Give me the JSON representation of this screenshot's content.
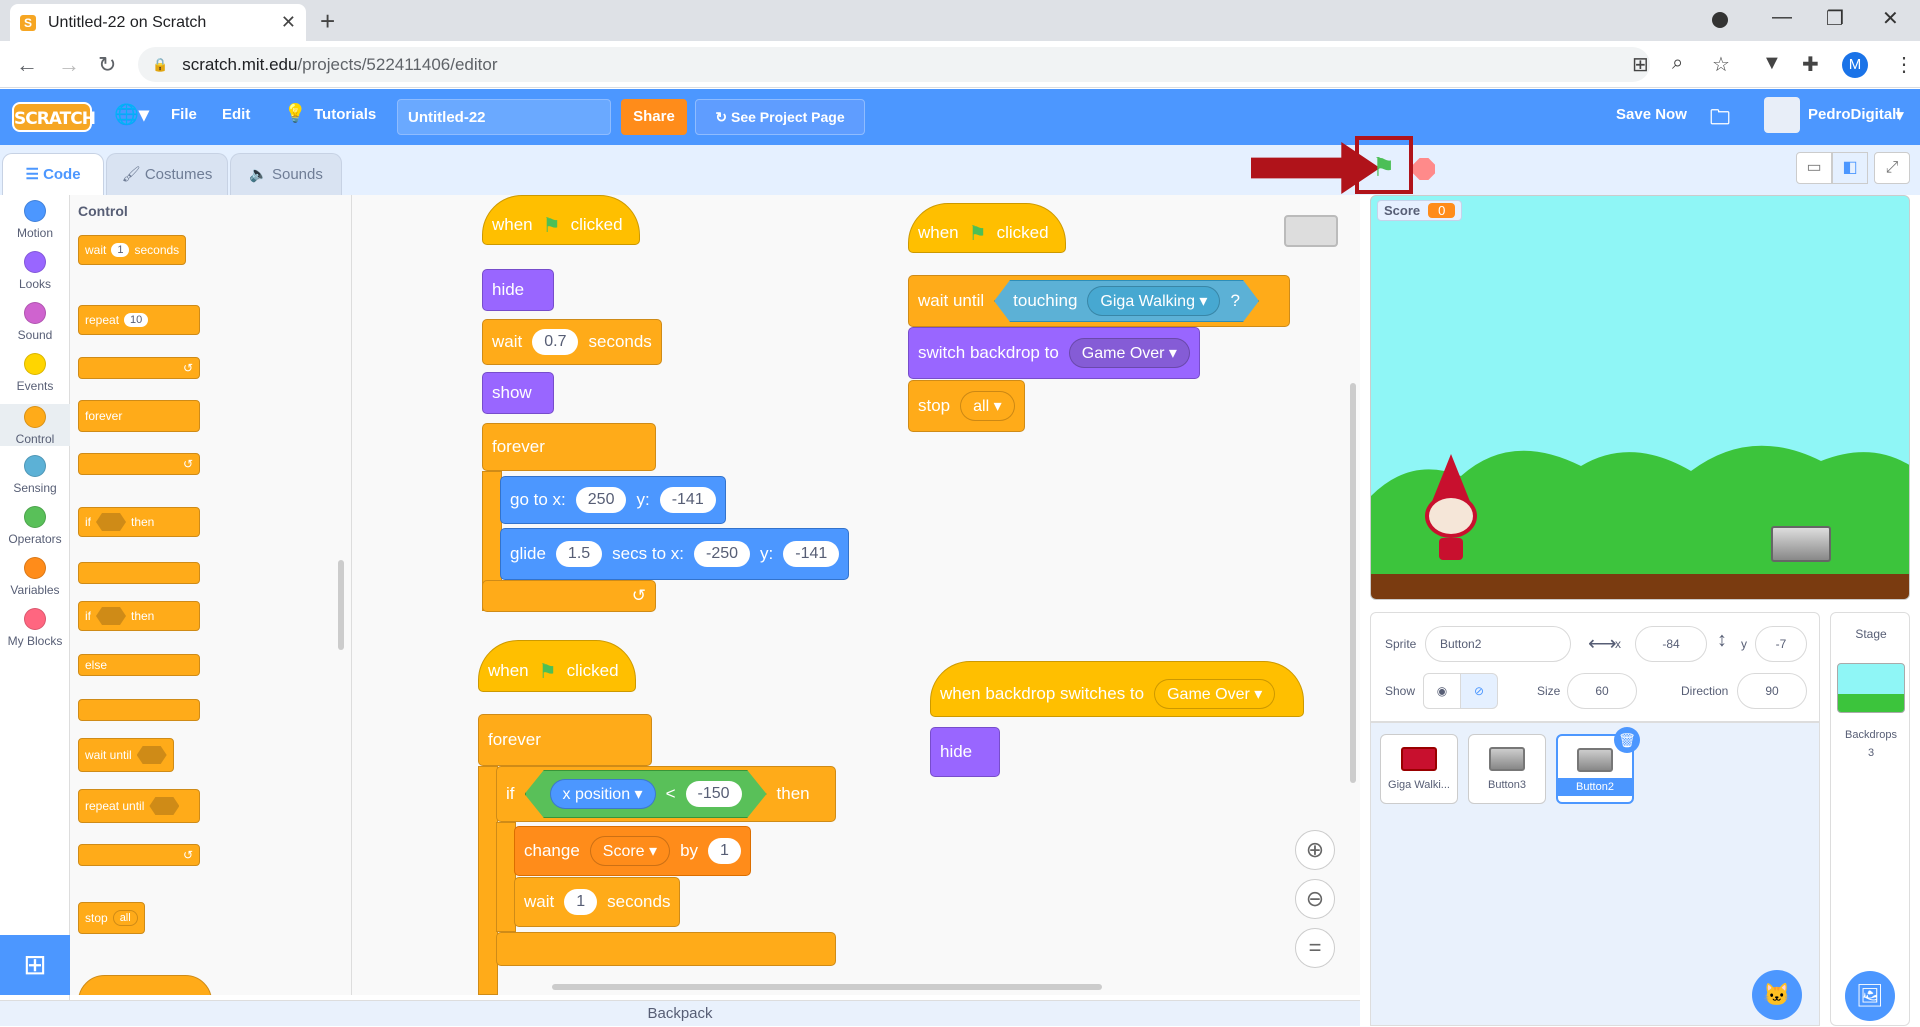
{
  "browser": {
    "tab_title": "Untitled-22 on Scratch",
    "url_host": "scratch.mit.edu",
    "url_path": "/projects/522411406/editor",
    "profile_initial": "M"
  },
  "menu": {
    "logo": "SCRATCH",
    "file": "File",
    "edit": "Edit",
    "tutorials": "Tutorials",
    "project_title": "Untitled-22",
    "share": "Share",
    "see_project": "See Project Page",
    "save_now": "Save Now",
    "username": "PedroDigitall"
  },
  "tabs": {
    "code": "Code",
    "costumes": "Costumes",
    "sounds": "Sounds"
  },
  "categories": [
    {
      "label": "Motion",
      "color": "#4c97ff"
    },
    {
      "label": "Looks",
      "color": "#9966ff"
    },
    {
      "label": "Sound",
      "color": "#cf63cf"
    },
    {
      "label": "Events",
      "color": "#ffd500"
    },
    {
      "label": "Control",
      "color": "#ffab19"
    },
    {
      "label": "Sensing",
      "color": "#5cb1d6"
    },
    {
      "label": "Operators",
      "color": "#59c059"
    },
    {
      "label": "Variables",
      "color": "#ff8c1a"
    },
    {
      "label": "My Blocks",
      "color": "#ff6680"
    }
  ],
  "palette": {
    "heading": "Control",
    "wait": "wait",
    "wait_val": "1",
    "seconds": "seconds",
    "repeat": "repeat",
    "repeat_val": "10",
    "forever": "forever",
    "if": "if",
    "then": "then",
    "else": "else",
    "wait_until": "wait until",
    "repeat_until": "repeat until",
    "stop": "stop",
    "stop_val": "all"
  },
  "scripts": {
    "s1": {
      "when": "when",
      "clicked": "clicked",
      "hide": "hide",
      "wait": "wait",
      "wait_val": "0.7",
      "seconds": "seconds",
      "show": "show",
      "forever": "forever",
      "goto": "go to x:",
      "goto_x": "250",
      "y": "y:",
      "goto_y": "-141",
      "glide": "glide",
      "glide_secs": "1.5",
      "secs_to_x": "secs to x:",
      "glide_x": "-250",
      "glide_y": "-141"
    },
    "s2": {
      "when": "when",
      "clicked": "clicked",
      "wait_until": "wait until",
      "touching": "touching",
      "target": "Giga Walking",
      "q": "?",
      "switch": "switch backdrop to",
      "backdrop": "Game Over",
      "stop": "stop",
      "stop_val": "all"
    },
    "s3": {
      "when": "when",
      "clicked": "clicked",
      "forever": "forever",
      "if": "if",
      "xpos": "x position",
      "lt": "<",
      "cmp": "-150",
      "then": "then",
      "change": "change",
      "var": "Score",
      "by": "by",
      "by_val": "1",
      "wait": "wait",
      "wait_val": "1",
      "seconds": "seconds"
    },
    "s4": {
      "when_backdrop": "when backdrop switches to",
      "backdrop": "Game Over",
      "hide": "hide"
    }
  },
  "stage": {
    "score_label": "Score",
    "score_value": "0"
  },
  "sprite_info": {
    "sprite_label": "Sprite",
    "sprite_name": "Button2",
    "x_label": "x",
    "x": "-84",
    "y_label": "y",
    "y": "-7",
    "show_label": "Show",
    "size_label": "Size",
    "size": "60",
    "direction_label": "Direction",
    "direction": "90"
  },
  "sprites": [
    "Giga Walki...",
    "Button3",
    "Button2"
  ],
  "stage_pane": {
    "title": "Stage",
    "backdrops_label": "Backdrops",
    "backdrops_count": "3"
  },
  "backpack": "Backpack"
}
